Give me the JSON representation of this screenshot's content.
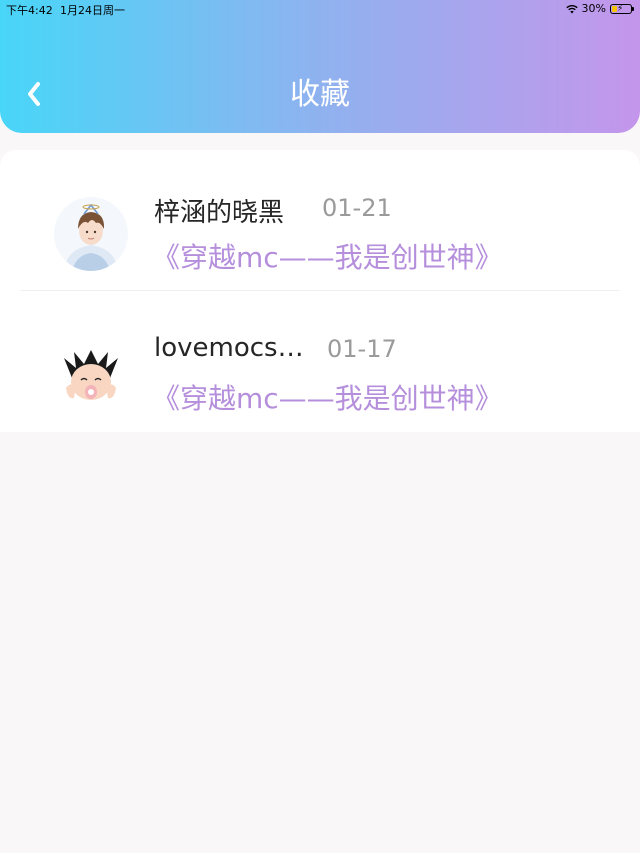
{
  "status_bar": {
    "time": "下午4:42",
    "date": "1月24日周一",
    "battery": "30%",
    "battery_level": 0.3
  },
  "header": {
    "title": "收藏",
    "back_icon": "chevron-left-icon"
  },
  "favorites": [
    {
      "username": "梓涵的晓黑",
      "date": "01-21",
      "book": "《穿越mc——我是创世神》",
      "avatar_icon": "anime-boy-avatar"
    },
    {
      "username": "lovemocsc…",
      "date": "01-17",
      "book": "《穿越mc——我是创世神》",
      "avatar_icon": "astro-boy-avatar"
    }
  ],
  "colors": {
    "gradient_start": "#48d6f8",
    "gradient_end": "#c496eb",
    "book_title": "#b58fdc",
    "date": "#9a9a9a",
    "background": "#f9f7f8"
  }
}
